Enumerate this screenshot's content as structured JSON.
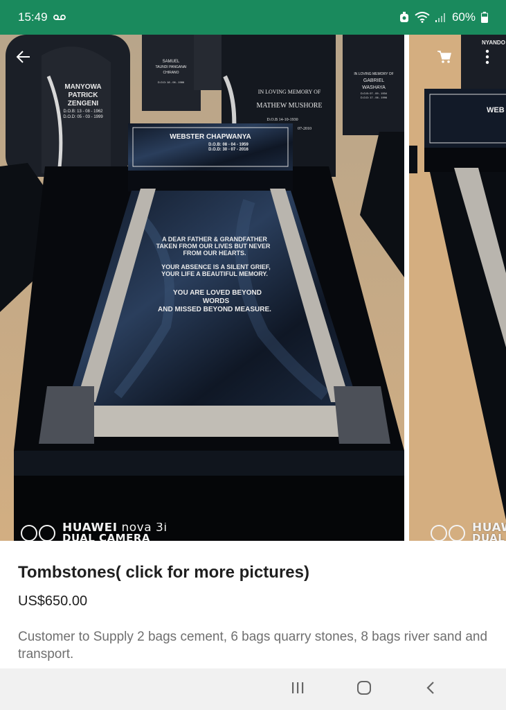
{
  "status_bar": {
    "time": "15:49",
    "battery_percent": "60%"
  },
  "gallery": {
    "watermark_brand": "HUAWEI",
    "watermark_model": "nova 3i",
    "watermark_sub": "DUAL CAMERA",
    "next_watermark_brand": "HUAW",
    "next_watermark_sub": "DUAL",
    "main_photo": {
      "headstone_name": "WEBSTER CHAPWANYA",
      "headstone_dob": "D.O.B: 08 - 04 - 1959",
      "headstone_dod": "D.O.D: 30 - 07 - 2016",
      "epitaph_lines": [
        "A DEAR FATHER & GRANDFATHER",
        "TAKEN FROM OUR LIVES BUT NEVER",
        "FROM OUR HEARTS.",
        "YOUR ABSENCE IS A SILENT GRIEF,",
        "YOUR LIFE A BEAUTIFUL MEMORY.",
        "YOU ARE LOVED BEYOND",
        "WORDS",
        "AND MISSED BEYOND MEASURE."
      ],
      "bg_stone_1_lines": [
        "MANYOWA",
        "PATRICK",
        "ZENGENI",
        "D.O.B: 13 - 08 - 1962",
        "D.O.D: 05 - 03 - 1999"
      ],
      "bg_stone_2_lines": [
        "SAMUEL",
        "TAUNDI PANGANAI",
        "CHIRANO",
        "D.O.D: 18 - 06 - 1986"
      ],
      "bg_stone_3_lines": [
        "IN LOVING MEMORY OF",
        "MATHEW MUSHORE",
        "D.O.B 14-10-1930",
        "07-2010"
      ],
      "bg_stone_4_lines": [
        "IN LOVING MEMORY OF",
        "GABRIEL",
        "WASHAYA",
        "D.O.B: 07 - 09 - 1934",
        "D.O.D: 17 - 06 - 1996"
      ]
    },
    "next_photo": {
      "headstone_partial": "WEB",
      "bg_partial": "NYANDO"
    }
  },
  "product": {
    "title": "Tombstones( click for more pictures)",
    "price": "US$650.00",
    "description": "Customer to Supply 2 bags cement, 6 bags quarry stones, 8 bags river sand and transport."
  },
  "colors": {
    "status_bar": "#1a8a5d",
    "ground": "#c9a57b",
    "granite_black": "#0d1118",
    "granite_grey": "#b9b5ae",
    "nav_bar": "#f1f1f1"
  },
  "icons": {
    "back": "arrow-left-icon",
    "cart": "cart-icon",
    "more": "more-vertical-icon",
    "nav_recents": "recents-icon",
    "nav_home": "home-icon",
    "nav_back": "chevron-left-icon"
  }
}
